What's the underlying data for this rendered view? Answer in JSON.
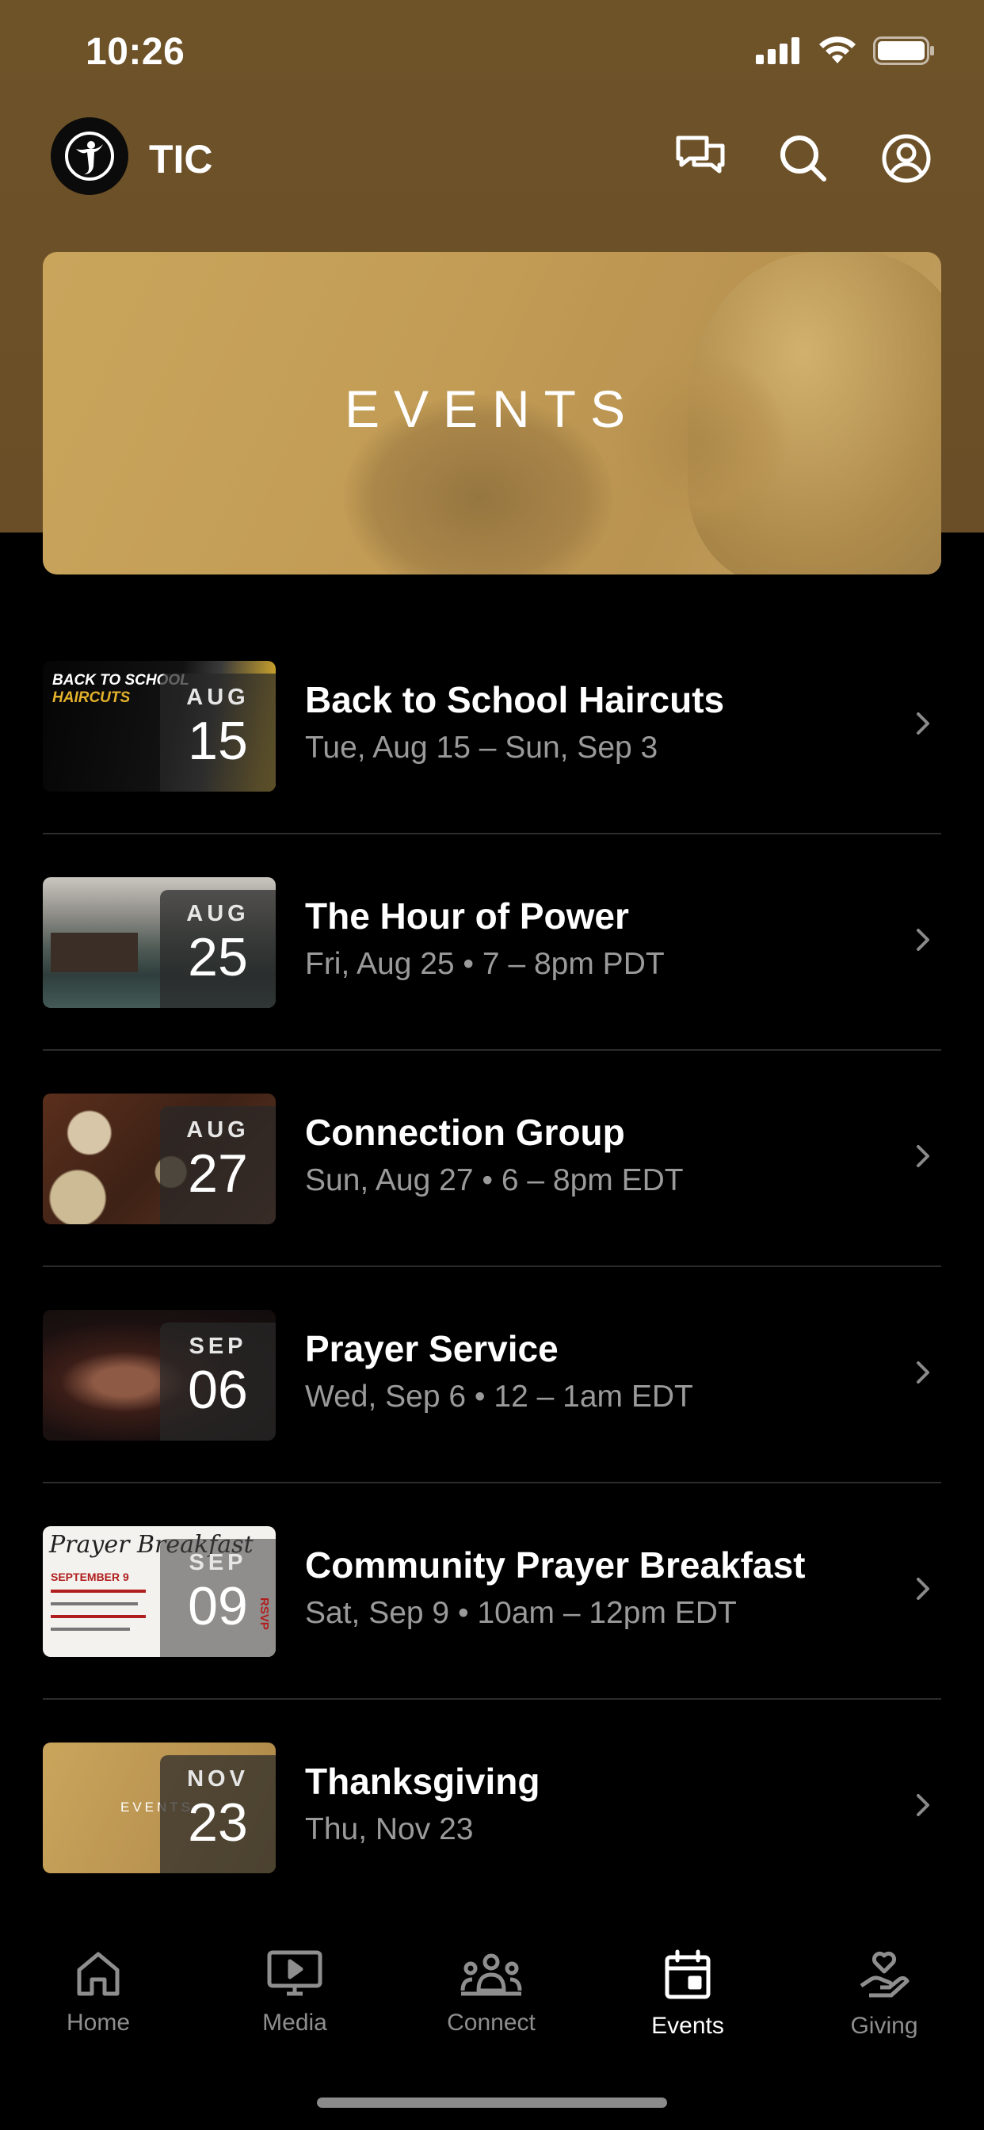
{
  "status_bar": {
    "time": "10:26"
  },
  "header": {
    "app_name": "TIC",
    "icons": [
      "logo-icon",
      "chat-icon",
      "search-icon",
      "profile-icon"
    ]
  },
  "banner": {
    "title": "EVENTS"
  },
  "events": [
    {
      "month": "AUG",
      "day": "15",
      "title": "Back to School Haircuts",
      "subtitle": "Tue, Aug 15 – Sun, Sep 3",
      "thumb_text": [
        "BACK TO SCHOOL",
        "HAIRCUTS"
      ]
    },
    {
      "month": "AUG",
      "day": "25",
      "title": "The Hour of Power",
      "subtitle": "Fri, Aug 25 • 7 – 8pm PDT"
    },
    {
      "month": "AUG",
      "day": "27",
      "title": "Connection Group",
      "subtitle": "Sun, Aug 27 • 6 – 8pm EDT"
    },
    {
      "month": "SEP",
      "day": "06",
      "title": "Prayer Service",
      "subtitle": "Wed, Sep 6 • 12 – 1am EDT"
    },
    {
      "month": "SEP",
      "day": "09",
      "title": "Community Prayer Breakfast",
      "subtitle": "Sat, Sep 9 • 10am – 12pm EDT",
      "thumb_text": [
        "Prayer Breakfast",
        "SEPTEMBER 9",
        "RSVP"
      ]
    },
    {
      "month": "NOV",
      "day": "23",
      "title": "Thanksgiving",
      "subtitle": "Thu, Nov 23",
      "thumb_text": [
        "EVENTS"
      ]
    }
  ],
  "tabs": [
    {
      "label": "Home",
      "icon": "home-icon",
      "active": false
    },
    {
      "label": "Media",
      "icon": "media-icon",
      "active": false
    },
    {
      "label": "Connect",
      "icon": "connect-icon",
      "active": false
    },
    {
      "label": "Events",
      "icon": "events-icon",
      "active": true
    },
    {
      "label": "Giving",
      "icon": "giving-icon",
      "active": false
    }
  ],
  "colors": {
    "header_bg": "#6e5228",
    "banner_bg": "#c29c55",
    "subtitle": "#9a9a9a",
    "tab_inactive": "#8e8e8e"
  }
}
